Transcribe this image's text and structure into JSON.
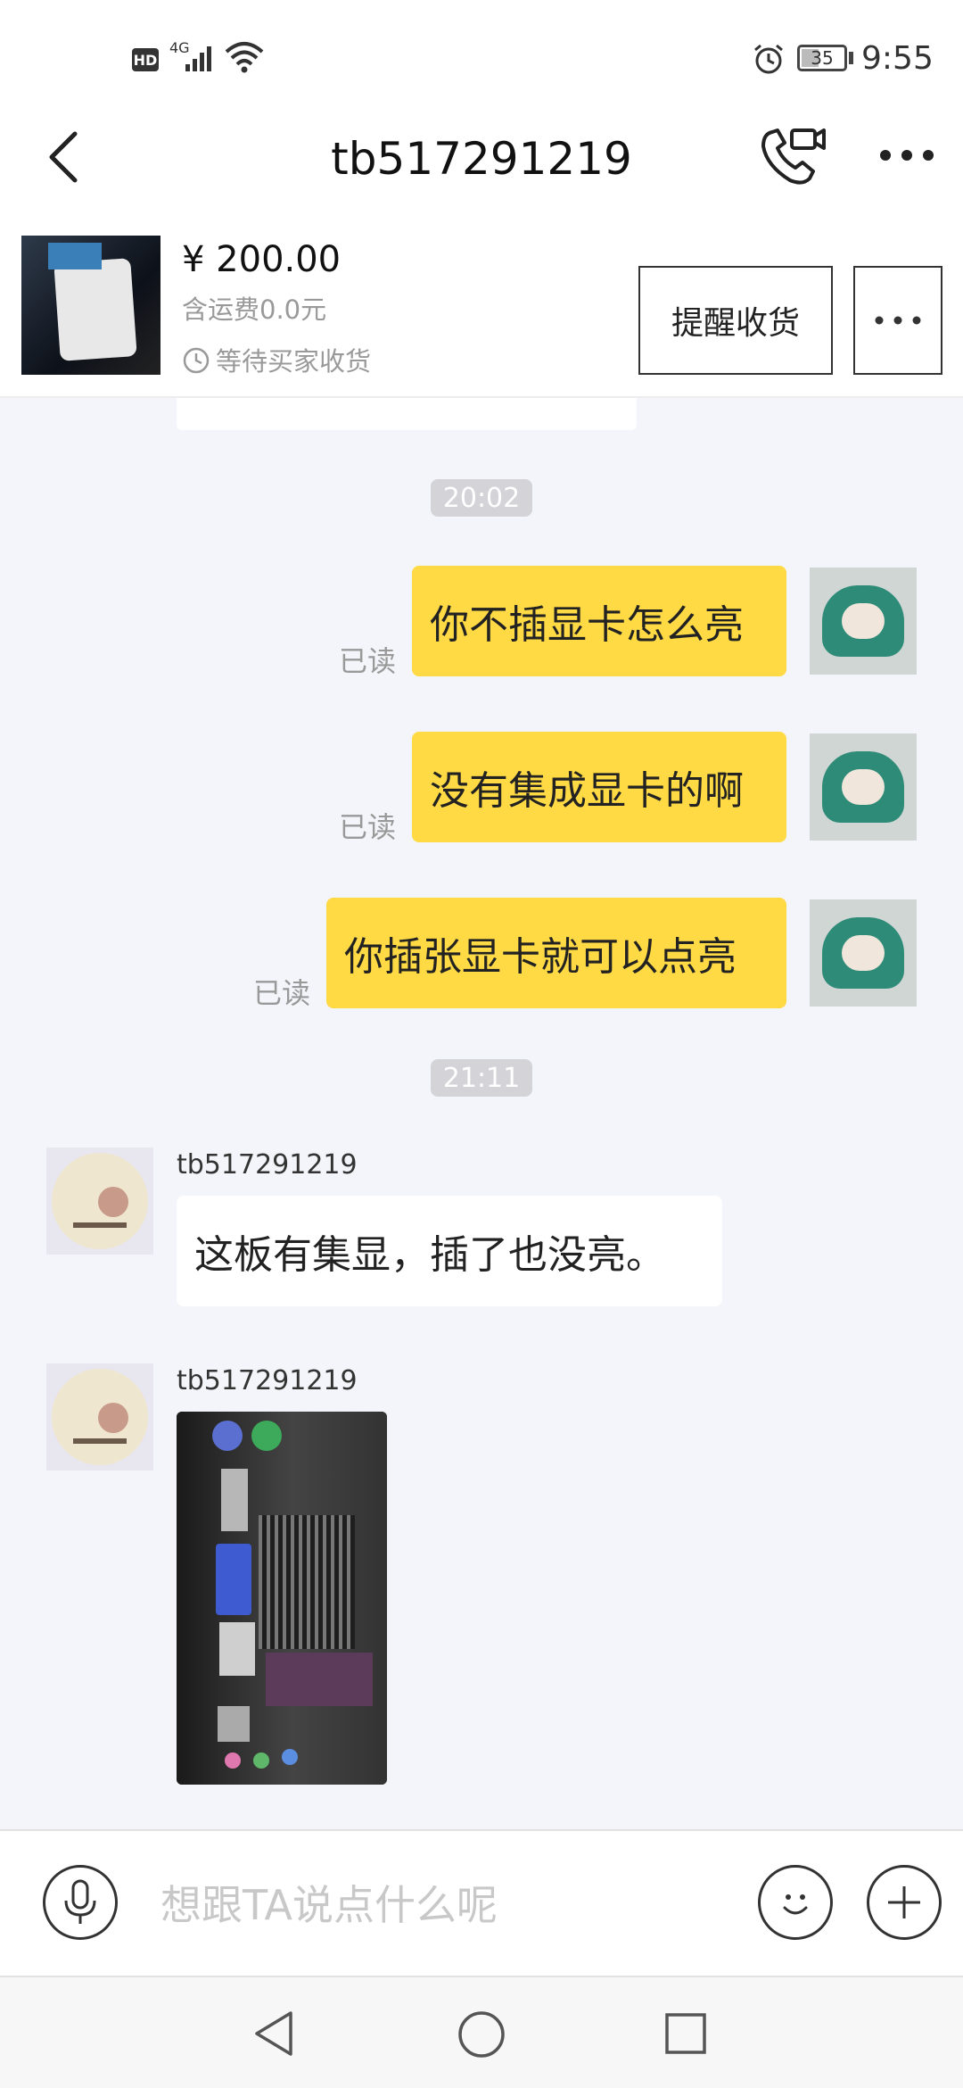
{
  "status_bar": {
    "hd": "HD",
    "network": "4G",
    "battery": "35",
    "time": "9:55"
  },
  "header": {
    "title": "tb517291219"
  },
  "order": {
    "price": "¥ 200.00",
    "shipping": "含运费0.0元",
    "status": "等待买家收货",
    "remind_button": "提醒收货"
  },
  "chat": {
    "timestamps": [
      "20:02",
      "21:11"
    ],
    "my_messages": [
      {
        "text": "你不插显卡怎么亮",
        "read": "已读"
      },
      {
        "text": "没有集成显卡的啊",
        "read": "已读"
      },
      {
        "text": "你插张显卡就可以点亮",
        "read": "已读"
      }
    ],
    "other_messages": [
      {
        "sender": "tb517291219",
        "text": "这板有集显，插了也没亮。"
      },
      {
        "sender": "tb517291219",
        "image_desc": "photo"
      }
    ]
  },
  "input": {
    "placeholder": "想跟TA说点什么呢"
  },
  "icons": {
    "back": "back-arrow-icon",
    "video_call": "video-call-icon",
    "more": "more-dots-icon",
    "clock": "clock-icon",
    "mic": "microphone-icon",
    "emoji": "emoji-icon",
    "plus": "plus-icon",
    "nav_back": "nav-back-icon",
    "nav_home": "nav-home-icon",
    "nav_recent": "nav-recent-icon",
    "alarm": "alarm-icon",
    "wifi": "wifi-icon",
    "signal": "signal-icon",
    "battery": "battery-icon"
  },
  "colors": {
    "my_bubble": "#ffda44",
    "chat_bg": "#f4f5fa",
    "timestamp_bg": "#d4d4d8"
  }
}
